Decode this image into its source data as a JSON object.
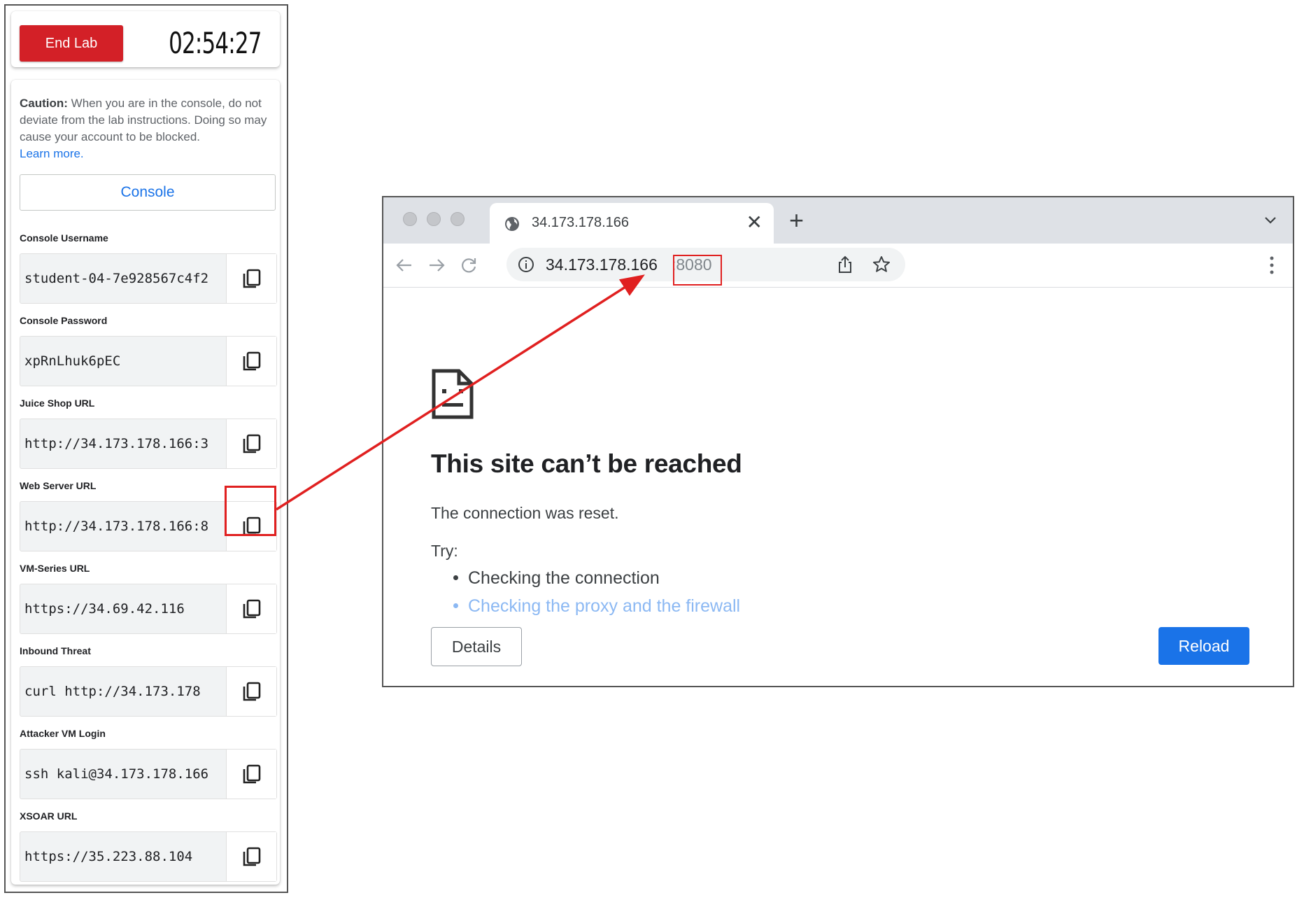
{
  "lab": {
    "end_label": "End Lab",
    "timer": "02:54:27",
    "caution_bold": "Caution:",
    "caution_text": " When you are in the console, do not deviate from the lab instructions. Doing so may cause your account to be blocked.",
    "learn_more": "Learn more.",
    "console_label": "Console",
    "fields": [
      {
        "label": "Console Username",
        "value": "student-04-7e928567c4f2"
      },
      {
        "label": "Console Password",
        "value": "xpRnLhuk6pEC"
      },
      {
        "label": "Juice Shop URL",
        "value": "http://34.173.178.166:3"
      },
      {
        "label": "Web Server URL",
        "value": "http://34.173.178.166:8"
      },
      {
        "label": "VM-Series URL",
        "value": "https://34.69.42.116"
      },
      {
        "label": "Inbound Threat",
        "value": "curl http://34.173.178"
      },
      {
        "label": "Attacker VM Login",
        "value": "ssh kali@34.173.178.166"
      },
      {
        "label": "XSOAR URL",
        "value": "https://35.223.88.104"
      }
    ]
  },
  "browser": {
    "tab_title": "34.173.178.166",
    "url_host": "34.173.178.166",
    "url_port": ":8080",
    "error_title": "This site can’t be reached",
    "error_message": "The connection was reset.",
    "try_label": "Try:",
    "suggestions": [
      "Checking the connection",
      "Checking the proxy and the firewall"
    ],
    "details_label": "Details",
    "reload_label": "Reload"
  },
  "colors": {
    "end_lab": "#d32027",
    "link_blue": "#1a73e8",
    "annotation_red": "#e02020"
  },
  "icons": [
    "copy-icon",
    "globe-icon",
    "close-icon",
    "plus-icon",
    "chevron-down-icon",
    "back-arrow-icon",
    "forward-arrow-icon",
    "reload-icon",
    "info-icon",
    "share-icon",
    "star-icon",
    "more-vert-icon",
    "sad-page-icon"
  ]
}
